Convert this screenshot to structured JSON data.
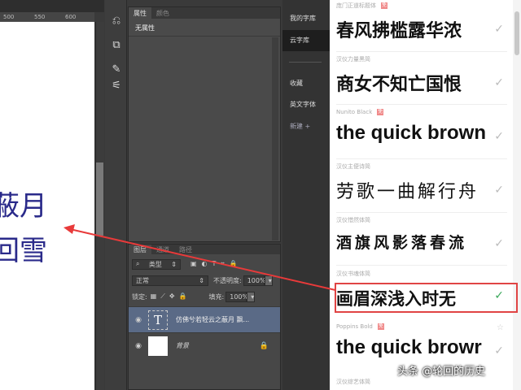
{
  "ruler": {
    "ticks": [
      "500",
      "550",
      "600"
    ]
  },
  "canvas": {
    "lines": [
      "蔽月",
      "回雪"
    ],
    "text_color": "#2a2a8a"
  },
  "properties": {
    "tabs": [
      "属性",
      "颜色"
    ],
    "empty_label": "无属性"
  },
  "layers_panel": {
    "tabs": [
      "图层",
      "通道",
      "路径"
    ],
    "filter": "类型",
    "blend_mode": "正常",
    "opacity_label": "不透明度:",
    "opacity": "100%",
    "lock_label": "锁定:",
    "fill_label": "填充:",
    "fill": "100%",
    "layers": [
      {
        "name": "仿佛兮若轻云之蔽月 飘...",
        "type": "text",
        "thumb": "T"
      },
      {
        "name": "背景",
        "type": "background"
      }
    ]
  },
  "font_sidebar": {
    "items": [
      "我的字库",
      "云字库",
      "收藏",
      "英文字体",
      "新建 +"
    ],
    "active": "云字库"
  },
  "font_list": [
    {
      "name": "庞门正道标题体",
      "tag": "免",
      "sample": "春风拂槛露华浓",
      "checked": false
    },
    {
      "name": "汉仪力量黑简",
      "sample": "商女不知亡国恨",
      "checked": false
    },
    {
      "name": "Nunito Black",
      "tag": "免",
      "sample": "the quick brown",
      "checked": false
    },
    {
      "name": "汉仪主便诗简",
      "sample": "劳歌一曲解行舟",
      "checked": false
    },
    {
      "name": "汉仪惜然体简",
      "sample": "酒旗风影落春流",
      "checked": false
    },
    {
      "name": "汉仪书魂体简",
      "sample": "画眉深浅入时无",
      "checked": true
    },
    {
      "name": "Poppins Bold",
      "tag": "免",
      "sample": "the quick browr",
      "checked": false
    },
    {
      "name": "汉仪综艺体简"
    }
  ],
  "watermark": "头条 @轮回的历史",
  "colors": {
    "highlight": "#e04444",
    "check_active": "#3aa85a",
    "arrow": "#e83a3a"
  }
}
